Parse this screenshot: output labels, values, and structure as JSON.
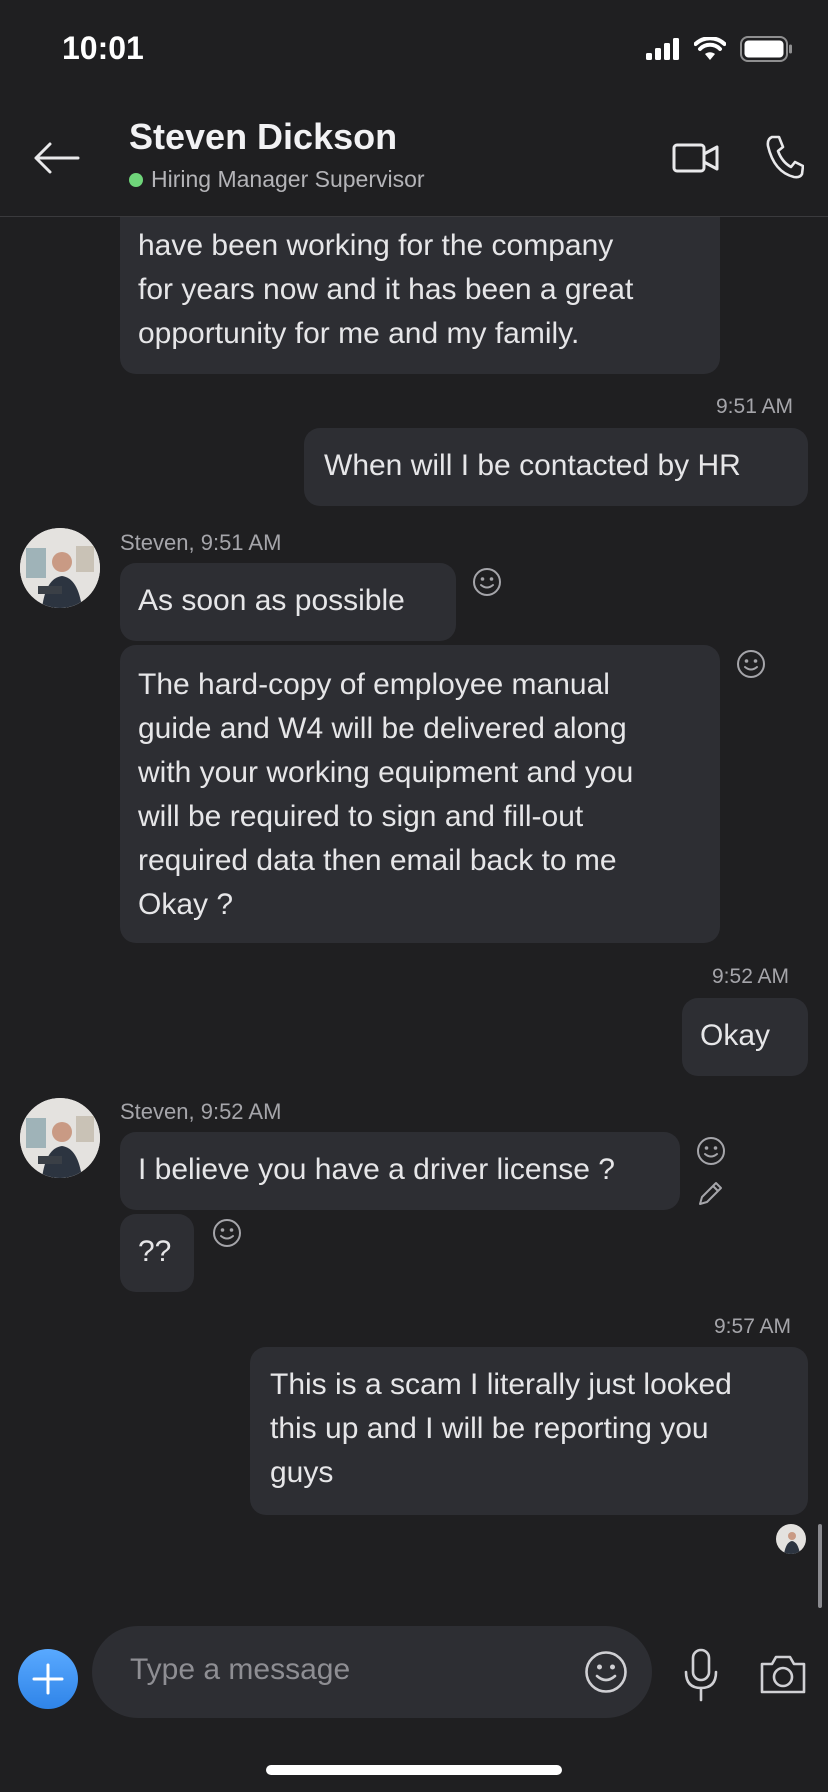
{
  "status_bar": {
    "time": "10:01"
  },
  "header": {
    "name": "Steven Dickson",
    "subtitle": "Hiring Manager Supervisor",
    "online_color": "#6fd57a",
    "icons": [
      "back-arrow-icon",
      "video-call-icon",
      "phone-icon"
    ]
  },
  "messages": {
    "m0": {
      "lines": [
        "have been working for the company",
        "for years now  and it has been a great",
        "opportunity for me and my family."
      ]
    },
    "ts1": "9:51 AM",
    "m1": "When will I be contacted by HR",
    "sender2": "Steven, 9:51 AM",
    "m2": "As soon as possible",
    "m3": {
      "lines": [
        "The hard-copy of employee manual",
        "guide and W4 will be delivered along",
        "with your working equipment and you",
        "will be required to sign and fill-out",
        "required data then email back to me",
        "Okay ?"
      ]
    },
    "ts4": "9:52 AM",
    "m4": "Okay",
    "sender5": "Steven, 9:52 AM",
    "m5": "I believe you have a driver license ?",
    "m6": "??",
    "ts7": "9:57 AM",
    "m7": {
      "lines": [
        "This is a scam I literally just looked",
        "this up and I will be reporting you",
        "guys"
      ]
    }
  },
  "composer": {
    "placeholder": "Type a message",
    "accent": "#3d93f5",
    "icons": [
      "plus-icon",
      "emoji-icon",
      "microphone-icon",
      "camera-icon"
    ]
  }
}
